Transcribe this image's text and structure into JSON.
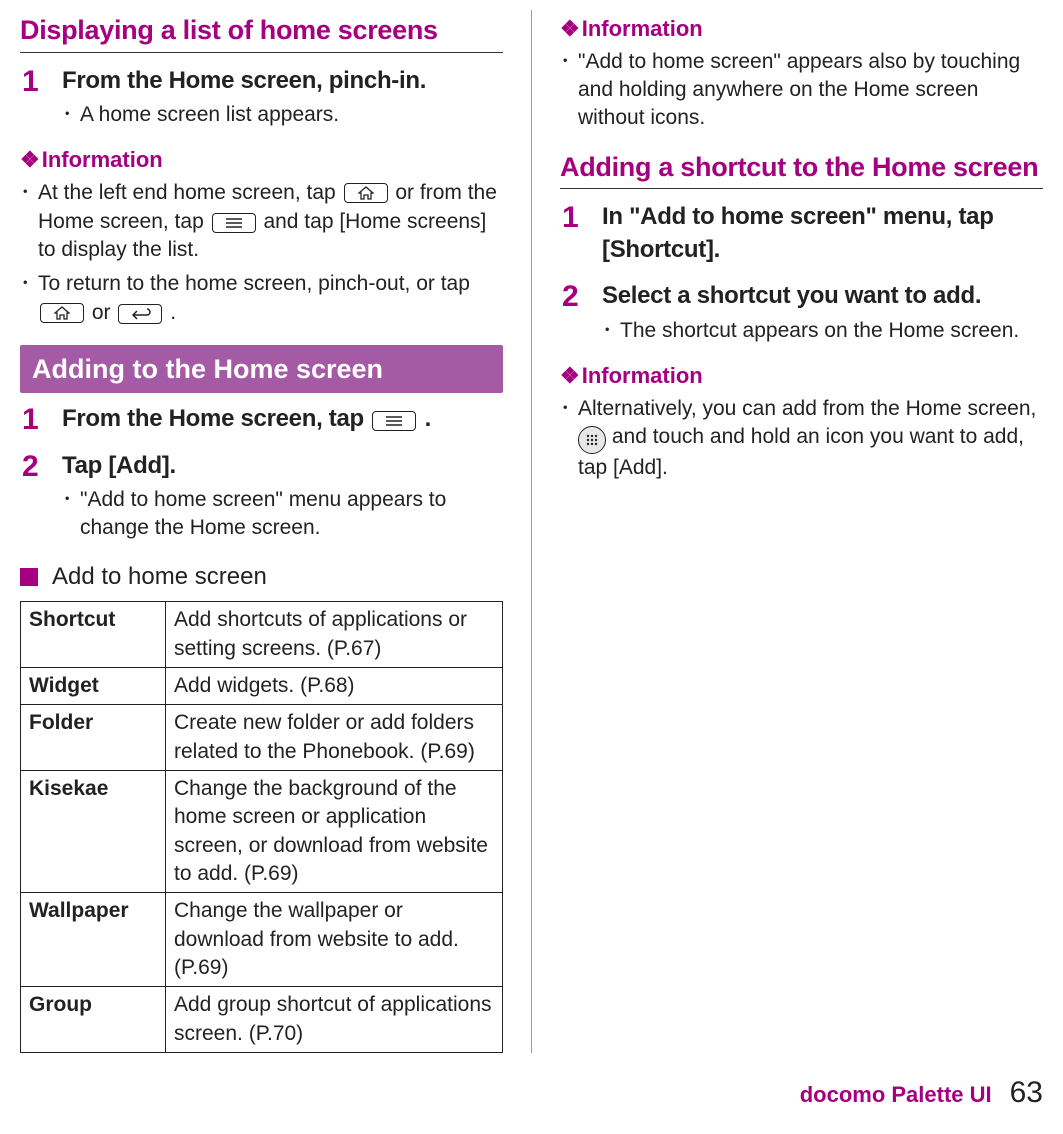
{
  "left": {
    "heading1": "Displaying a list of home screens",
    "step1": {
      "num": "1",
      "title": "From the Home screen, pinch-in.",
      "bullet": "A home screen list appears."
    },
    "info1_title": "Information",
    "info1": [
      {
        "pre": "At the left end home screen, tap ",
        "mid1": " or from the Home screen, tap ",
        "mid2": " and tap [Home screens] to display the list."
      },
      {
        "pre": "To return to the home screen, pinch-out, or tap ",
        "mid1": " or ",
        "post": " ."
      }
    ],
    "heading2": "Adding to the Home screen",
    "step2a": {
      "num": "1",
      "title_pre": "From the Home screen, tap ",
      "title_post": " ."
    },
    "step2b": {
      "num": "2",
      "title": "Tap [Add].",
      "bullet": "\"Add to home screen\" menu appears to change the Home screen."
    },
    "sub": "Add to home screen",
    "table": [
      {
        "k": "Shortcut",
        "v": "Add shortcuts of applications or setting screens. (P.67)"
      },
      {
        "k": "Widget",
        "v": "Add widgets. (P.68)"
      },
      {
        "k": "Folder",
        "v": "Create new folder or add folders related to the Phonebook. (P.69)"
      },
      {
        "k": "Kisekae",
        "v": "Change the background of the home screen or application screen, or download from website to add. (P.69)"
      },
      {
        "k": "Wallpaper",
        "v": "Change the wallpaper or download from website to add. (P.69)"
      },
      {
        "k": "Group",
        "v": "Add group shortcut of applications screen. (P.70)"
      }
    ]
  },
  "right": {
    "info1_title": "Information",
    "info1_text": "\"Add to home screen\" appears also by touching and holding anywhere on the Home screen without icons.",
    "heading1": "Adding a shortcut to the Home screen",
    "step1": {
      "num": "1",
      "title": "In \"Add to home screen\" menu, tap [Shortcut]."
    },
    "step2": {
      "num": "2",
      "title": "Select a shortcut you want to add.",
      "bullet": "The shortcut appears on the Home screen."
    },
    "info2_title": "Information",
    "info2_pre": "Alternatively, you can add from the Home screen, ",
    "info2_post": " and touch and hold an icon you want to add, tap [Add]."
  },
  "footer": {
    "title": "docomo Palette UI",
    "page": "63"
  }
}
